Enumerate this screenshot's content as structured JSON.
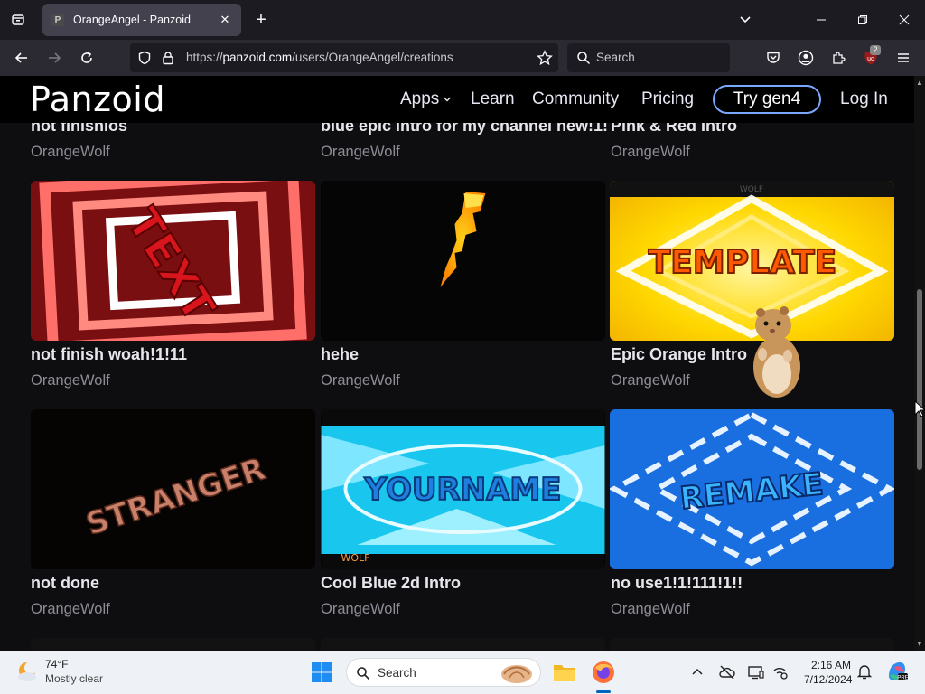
{
  "browser": {
    "tab": {
      "favicon_letter": "P",
      "title": "OrangeAngel - Panzoid"
    },
    "url": {
      "prefix": "https://",
      "domain": "panzoid.com",
      "path": "/users/OrangeAngel/creations"
    },
    "search_placeholder": "Search",
    "extension_badge": "2"
  },
  "site": {
    "logo": "Panzoid",
    "nav": {
      "apps": "Apps",
      "learn": "Learn",
      "community": "Community",
      "pricing": "Pricing",
      "try_button": "Try gen4",
      "login": "Log In"
    }
  },
  "creations": {
    "top_row": [
      {
        "title": "not finishios",
        "author": "OrangeWolf"
      },
      {
        "title": "blue epic intro for my channel new!1!",
        "author": "OrangeWolf"
      },
      {
        "title": "Pink & Red Intro",
        "author": "OrangeWolf"
      }
    ],
    "row2": [
      {
        "title": "not finish woah!1!11",
        "author": "OrangeWolf",
        "thumb_text": "TEXT"
      },
      {
        "title": "hehe",
        "author": "OrangeWolf",
        "thumb_text": ""
      },
      {
        "title": "Epic Orange Intro",
        "author": "OrangeWolf",
        "thumb_text": "TEMPLATE",
        "thumb_watermark": "WOLF"
      }
    ],
    "row3": [
      {
        "title": "not done",
        "author": "OrangeWolf",
        "thumb_text": "STRANGER"
      },
      {
        "title": "Cool Blue 2d Intro",
        "author": "OrangeWolf",
        "thumb_text": "YOURNAME",
        "thumb_watermark": "WOLF"
      },
      {
        "title": "no use1!1!111!1!!",
        "author": "OrangeWolf",
        "thumb_text": "REMAKE"
      }
    ]
  },
  "taskbar": {
    "weather": {
      "temp": "74°F",
      "desc": "Mostly clear"
    },
    "search_placeholder": "Search",
    "time": "2:16 AM",
    "date": "7/12/2024"
  }
}
